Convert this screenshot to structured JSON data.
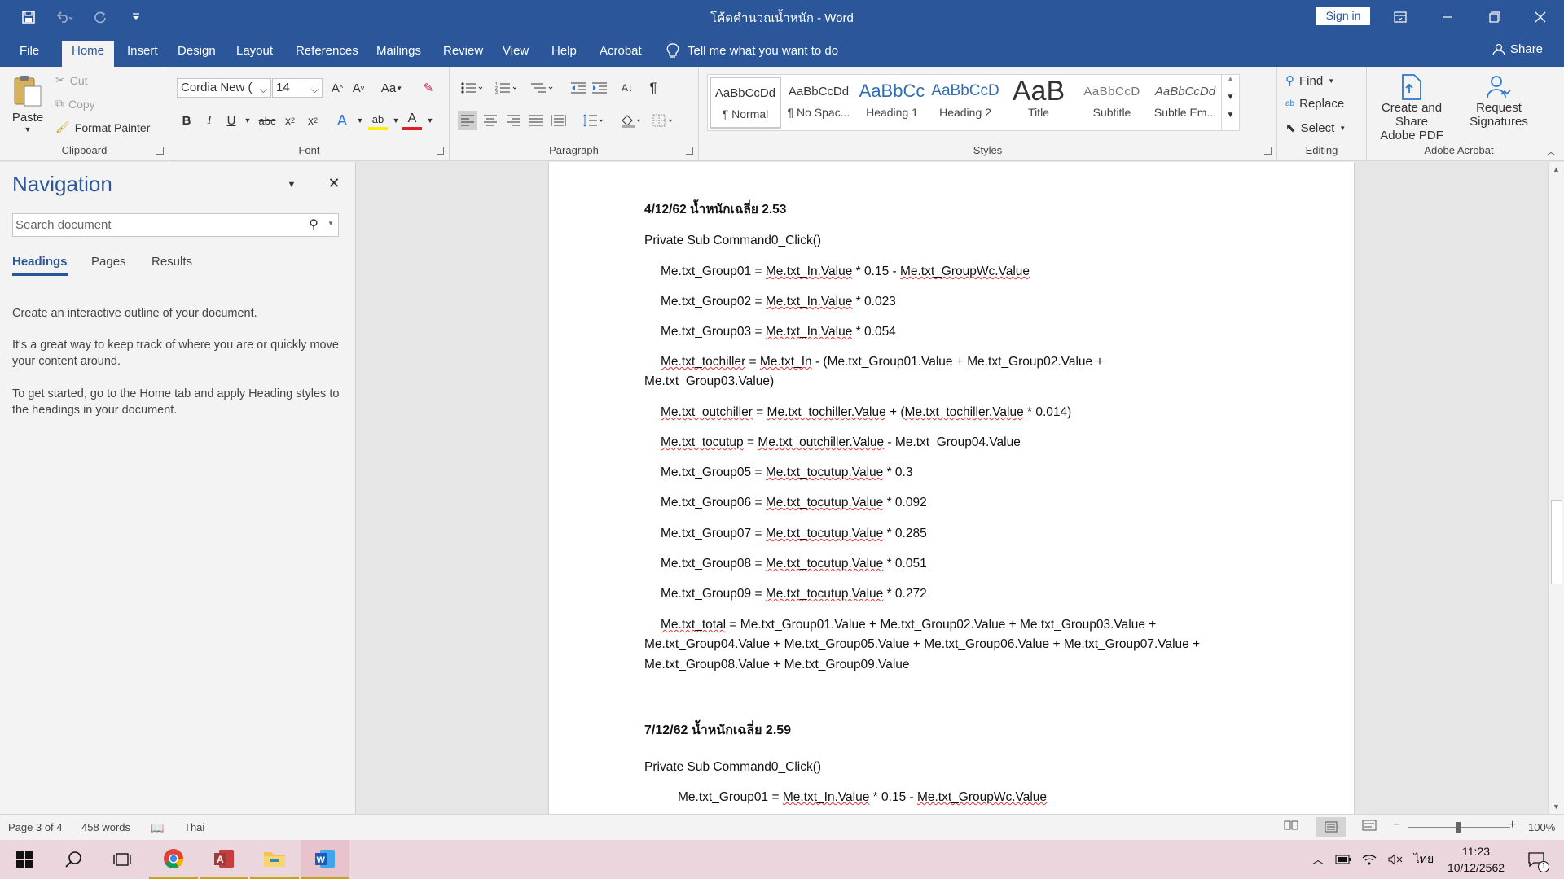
{
  "window": {
    "title": "โค้ดคำนวณน้ำหนัก  -  Word",
    "sign_in": "Sign in"
  },
  "tabs": [
    "File",
    "Home",
    "Insert",
    "Design",
    "Layout",
    "References",
    "Mailings",
    "Review",
    "View",
    "Help",
    "Acrobat"
  ],
  "tell_me": "Tell me what you want to do",
  "share": "Share",
  "ribbon": {
    "clipboard": {
      "paste": "Paste",
      "cut": "Cut",
      "copy": "Copy",
      "format_painter": "Format Painter",
      "label": "Clipboard"
    },
    "font": {
      "name": "Cordia New (",
      "size": "14",
      "label": "Font"
    },
    "paragraph": {
      "label": "Paragraph"
    },
    "styles": {
      "label": "Styles",
      "items": [
        {
          "preview": "AaBbCcDd",
          "name": "¶ Normal"
        },
        {
          "preview": "AaBbCcDd",
          "name": "¶ No Spac..."
        },
        {
          "preview": "AaBbCc",
          "name": "Heading 1"
        },
        {
          "preview": "AaBbCcD",
          "name": "Heading 2"
        },
        {
          "preview": "AaB",
          "name": "Title"
        },
        {
          "preview": "AaBbCcD",
          "name": "Subtitle"
        },
        {
          "preview": "AaBbCcDd",
          "name": "Subtle Em..."
        }
      ]
    },
    "editing": {
      "find": "Find",
      "replace": "Replace",
      "select": "Select",
      "label": "Editing"
    },
    "acrobat": {
      "create_share_1": "Create and Share",
      "create_share_2": "Adobe PDF",
      "request_1": "Request",
      "request_2": "Signatures",
      "label": "Adobe Acrobat"
    }
  },
  "navigation": {
    "title": "Navigation",
    "search_placeholder": "Search document",
    "tabs": [
      "Headings",
      "Pages",
      "Results"
    ],
    "p1": "Create an interactive outline of your document.",
    "p2": "It's a great way to keep track of where you are or quickly move your content around.",
    "p3": "To get started, go to the Home tab and apply Heading styles to the headings in your document."
  },
  "document": {
    "h1": "4/12/62 น้ำหนักเฉลี่ย 2.53",
    "l1": "Private Sub Command0_Click()",
    "l2a": "Me.txt_Group01 = ",
    "l2b": "Me.txt_In.Value",
    "l2c": " * 0.15 - ",
    "l2d": "Me.txt_GroupWc.Value",
    "l3a": "Me.txt_Group02 = ",
    "l3b": "Me.txt_In.Value",
    "l3c": " * 0.023",
    "l4a": "Me.txt_Group03 = ",
    "l4b": "Me.txt_In.Value",
    "l4c": " * 0.054",
    "l5a": "Me.txt_tochiller",
    "l5b": " = ",
    "l5c": "Me.txt_In",
    "l5d": " - (Me.txt_Group01.Value + Me.txt_Group02.Value +",
    "l5e": "Me.txt_Group03.Value)",
    "l6a": "Me.txt_outchiller",
    "l6b": " = ",
    "l6c": "Me.txt_tochiller.Value",
    "l6d": " + (",
    "l6e": "Me.txt_tochiller.Value",
    "l6f": " * 0.014)",
    "l7a": "Me.txt_tocutup",
    "l7b": " = ",
    "l7c": "Me.txt_outchiller.Value",
    "l7d": " - Me.txt_Group04.Value",
    "l8a": "Me.txt_Group05 = ",
    "l8b": "Me.txt_tocutup.Value",
    "l8c": " * 0.3",
    "l9a": "Me.txt_Group06 = ",
    "l9b": "Me.txt_tocutup.Value",
    "l9c": " * 0.092",
    "l10a": "Me.txt_Group07 = ",
    "l10b": "Me.txt_tocutup.Value",
    "l10c": " * 0.285",
    "l11a": "Me.txt_Group08 = ",
    "l11b": "Me.txt_tocutup.Value",
    "l11c": " * 0.051",
    "l12a": "Me.txt_Group09 = ",
    "l12b": "Me.txt_tocutup.Value",
    "l12c": " * 0.272",
    "l13a": "Me.txt_total",
    "l13b": " = Me.txt_Group01.Value + Me.txt_Group02.Value + Me.txt_Group03.Value +",
    "l13c": "Me.txt_Group04.Value + Me.txt_Group05.Value + Me.txt_Group06.Value + Me.txt_Group07.Value +",
    "l13d": "Me.txt_Group08.Value + Me.txt_Group09.Value",
    "h2": "7/12/62 น้ำหนักเฉลี่ย 2.59",
    "l14": "Private Sub Command0_Click()",
    "l15a": "Me.txt_Group01 = ",
    "l15b": "Me.txt_In.Value",
    "l15c": " * 0.15 - ",
    "l15d": "Me.txt_GroupWc.Value"
  },
  "status": {
    "page": "Page 3 of 4",
    "words": "458 words",
    "language": "Thai",
    "zoom": "100%",
    "zoom_value_percent": 100
  },
  "taskbar": {
    "lang": "ไทย",
    "time": "11:23",
    "date": "10/12/2562",
    "notif_count": "1"
  },
  "colors": {
    "brand": "#2b579a",
    "squiggle": "#d33333"
  }
}
